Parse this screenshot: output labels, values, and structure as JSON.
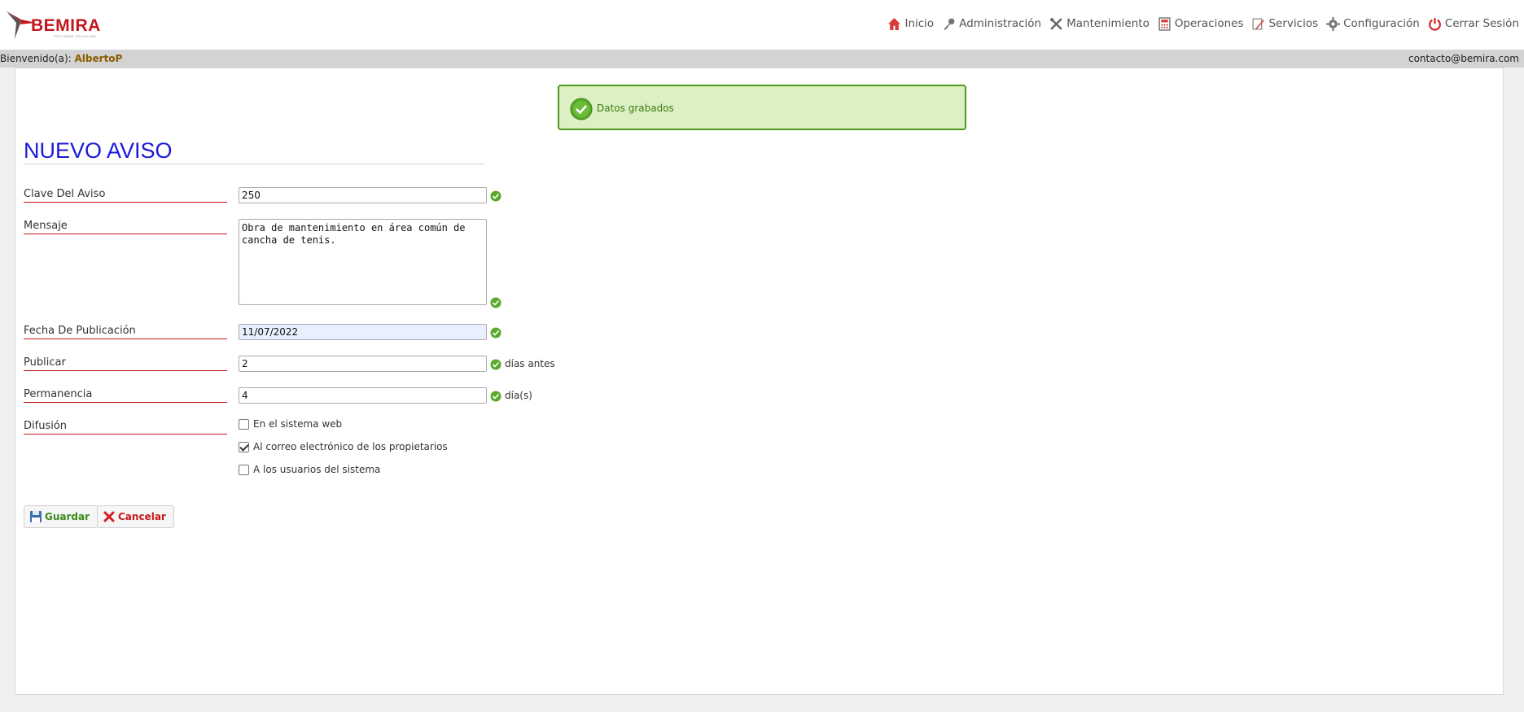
{
  "header": {
    "logo_text": "BEMIRA",
    "logo_sub": "SOFTWARE SOLUTIONS",
    "nav": [
      {
        "label": "Inicio",
        "icon": "home-icon"
      },
      {
        "label": "Administración",
        "icon": "key-icon"
      },
      {
        "label": "Mantenimiento",
        "icon": "tools-icon"
      },
      {
        "label": "Operaciones",
        "icon": "calculator-icon"
      },
      {
        "label": "Servicios",
        "icon": "pencil-icon"
      },
      {
        "label": "Configuración",
        "icon": "gear-icon"
      },
      {
        "label": "Cerrar Sesión",
        "icon": "power-icon"
      }
    ]
  },
  "welcome": {
    "prefix": "Bienvenido(a): ",
    "user": "AlbertoP",
    "email": "contacto@bemira.com"
  },
  "alert": {
    "text": "Datos grabados",
    "color": "#4b9a1c"
  },
  "form": {
    "title": "NUEVO AVISO",
    "clave_label": "Clave Del Aviso",
    "clave_value": "250",
    "mensaje_label": "Mensaje",
    "mensaje_value": "Obra de mantenimiento en área común de cancha de tenis.",
    "fecha_label": "Fecha De Publicación",
    "fecha_value": "11/07/2022",
    "publicar_label": "Publicar",
    "publicar_value": "2",
    "publicar_suffix": "días antes",
    "permanencia_label": "Permanencia",
    "permanencia_value": "4",
    "permanencia_suffix": "día(s)",
    "difusion_label": "Difusión",
    "difusion_options": [
      {
        "label": "En el sistema web",
        "checked": false
      },
      {
        "label": "Al correo electrónico de los propietarios",
        "checked": true
      },
      {
        "label": "A los usuarios del sistema",
        "checked": false
      }
    ]
  },
  "buttons": {
    "save": "Guardar",
    "cancel": "Cancelar"
  },
  "colors": {
    "title": "#1a1ad9",
    "label_underline": "#c8161c",
    "brand": "#c4161c"
  }
}
